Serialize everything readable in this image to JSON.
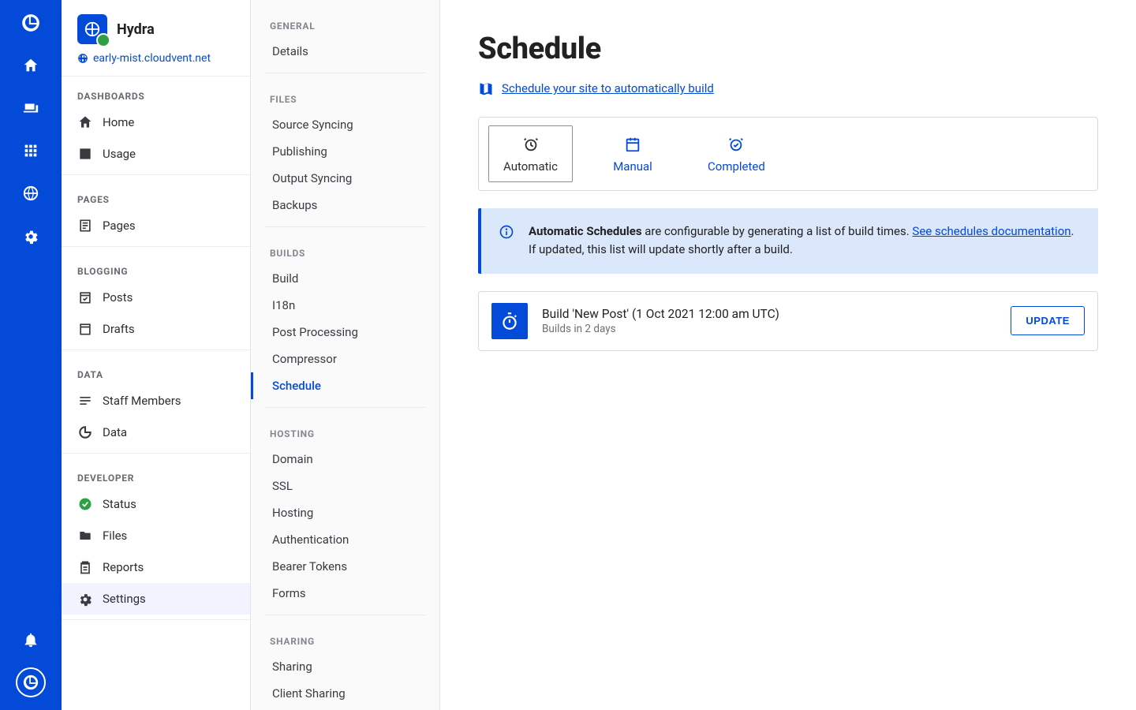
{
  "rail": {
    "icons": [
      "logo",
      "home",
      "devices",
      "apps",
      "globe",
      "settings"
    ],
    "bottom_icons": [
      "notifications",
      "avatar"
    ]
  },
  "site": {
    "name": "Hydra",
    "url": "early-mist.cloudvent.net"
  },
  "sidebar": {
    "groups": [
      {
        "title": "DASHBOARDS",
        "items": [
          {
            "label": "Home",
            "icon": "home"
          },
          {
            "label": "Usage",
            "icon": "bar-chart"
          }
        ]
      },
      {
        "title": "PAGES",
        "items": [
          {
            "label": "Pages",
            "icon": "page"
          }
        ]
      },
      {
        "title": "BLOGGING",
        "items": [
          {
            "label": "Posts",
            "icon": "calendar-check"
          },
          {
            "label": "Drafts",
            "icon": "calendar-draft"
          }
        ]
      },
      {
        "title": "DATA",
        "items": [
          {
            "label": "Staff Members",
            "icon": "list"
          },
          {
            "label": "Data",
            "icon": "donut"
          }
        ]
      },
      {
        "title": "DEVELOPER",
        "items": [
          {
            "label": "Status",
            "icon": "check-circle",
            "ok": true
          },
          {
            "label": "Files",
            "icon": "folder"
          },
          {
            "label": "Reports",
            "icon": "clipboard"
          },
          {
            "label": "Settings",
            "icon": "gear",
            "active": true
          }
        ]
      }
    ]
  },
  "subnav": {
    "groups": [
      {
        "title": "GENERAL",
        "items": [
          "Details"
        ]
      },
      {
        "title": "FILES",
        "items": [
          "Source Syncing",
          "Publishing",
          "Output Syncing",
          "Backups"
        ]
      },
      {
        "title": "BUILDS",
        "items": [
          "Build",
          "I18n",
          "Post Processing",
          "Compressor",
          "Schedule"
        ],
        "active": "Schedule"
      },
      {
        "title": "HOSTING",
        "items": [
          "Domain",
          "SSL",
          "Hosting",
          "Authentication",
          "Bearer Tokens",
          "Forms"
        ]
      },
      {
        "title": "SHARING",
        "items": [
          "Sharing",
          "Client Sharing"
        ]
      }
    ]
  },
  "main": {
    "title": "Schedule",
    "hint_link": "Schedule your site to automatically build",
    "tabs": [
      {
        "label": "Automatic",
        "active": true,
        "icon": "alarm"
      },
      {
        "label": "Manual",
        "icon": "calendar"
      },
      {
        "label": "Completed",
        "icon": "alarm-check"
      }
    ],
    "banner": {
      "strong": "Automatic Schedules",
      "text_before_link": " are configurable by generating a list of build times. ",
      "link": "See schedules documentation",
      "text_after_link": ". If updated, this list will update shortly after a build."
    },
    "schedule_item": {
      "title": "Build 'New Post' (1 Oct 2021 12:00 am UTC)",
      "subtitle": "Builds in 2 days",
      "button": "Update"
    }
  }
}
